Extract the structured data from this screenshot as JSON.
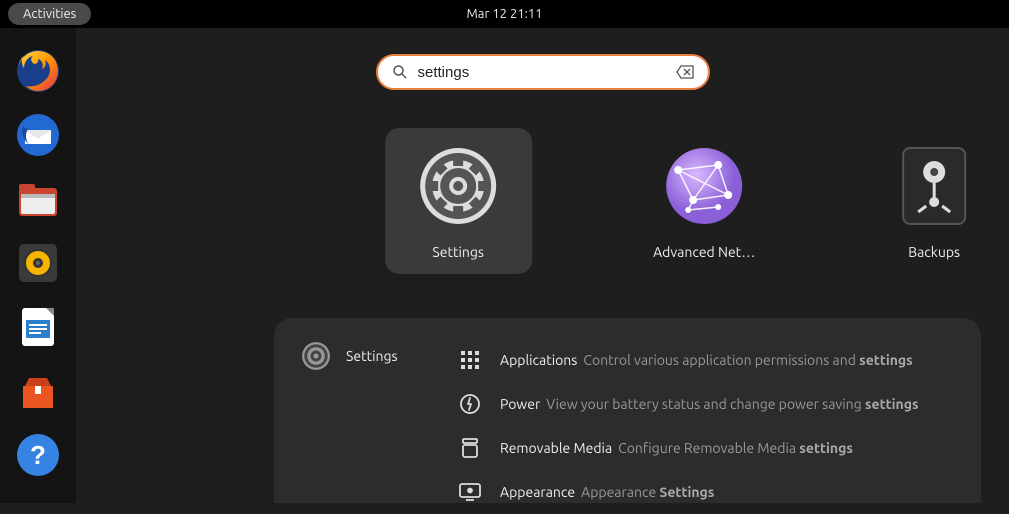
{
  "topbar": {
    "activities": "Activities",
    "clock": "Mar 12  21:11"
  },
  "dock": [
    {
      "name": "firefox"
    },
    {
      "name": "thunderbird"
    },
    {
      "name": "files"
    },
    {
      "name": "rhythmbox"
    },
    {
      "name": "libreoffice"
    },
    {
      "name": "software"
    },
    {
      "name": "help"
    }
  ],
  "search": {
    "value": "settings"
  },
  "apps": [
    {
      "label": "Settings",
      "selected": true
    },
    {
      "label": "Advanced Net…",
      "selected": false
    },
    {
      "label": "Backups",
      "selected": false
    }
  ],
  "panel": {
    "title": "Settings",
    "items": [
      {
        "main": "Applications",
        "sub_prefix": "Control various application permissions and ",
        "sub_bold": "settings"
      },
      {
        "main": "Power",
        "sub_prefix": "View your battery status and change power saving ",
        "sub_bold": "settings"
      },
      {
        "main": "Removable Media",
        "sub_prefix": "Configure Removable Media ",
        "sub_bold": "settings"
      },
      {
        "main": "Appearance",
        "sub_prefix": "Appearance ",
        "sub_bold": "Settings"
      }
    ]
  }
}
